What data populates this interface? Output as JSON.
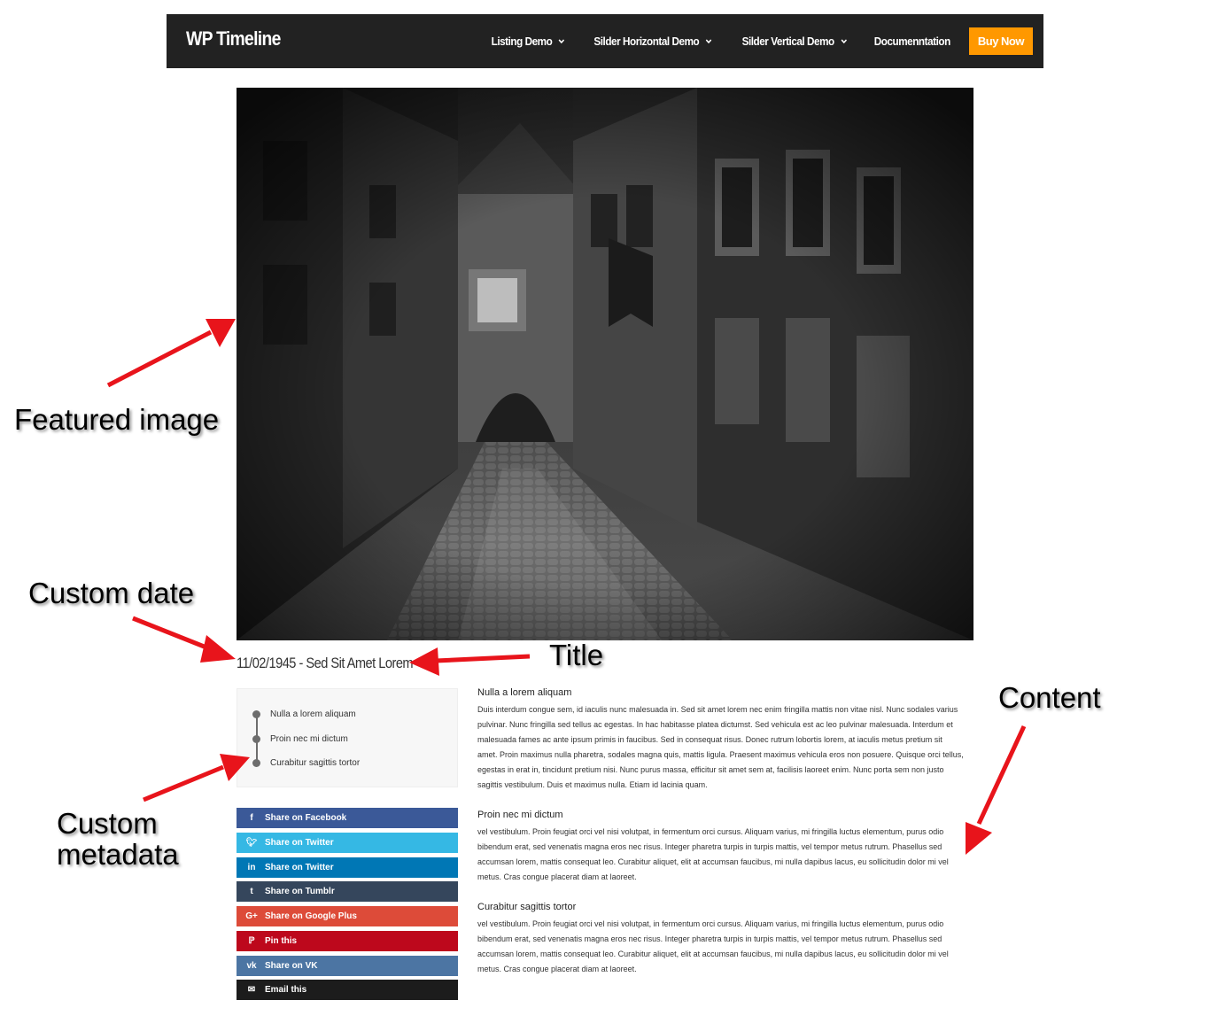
{
  "navbar": {
    "brand": "WP Timeline",
    "menu": [
      {
        "label": "Listing Demo",
        "has_dropdown": true
      },
      {
        "label": "Silder Horizontal Demo",
        "has_dropdown": true
      },
      {
        "label": "Silder Vertical Demo",
        "has_dropdown": true
      },
      {
        "label": "Documenntation",
        "has_dropdown": false
      }
    ],
    "buy_label": "Buy Now",
    "buy_color": "#ff9800"
  },
  "post": {
    "title": "11/02/1945 - Sed Sit Amet Lorem"
  },
  "metadata": [
    "Nulla a lorem aliquam",
    "Proin nec mi dictum",
    "Curabitur sagittis tortor"
  ],
  "share": [
    {
      "label": "Share on Facebook",
      "icon": "facebook-icon",
      "color": "#3b5998"
    },
    {
      "label": "Share on Twitter",
      "icon": "twitter-icon",
      "color": "#35b8e4"
    },
    {
      "label": "Share on Twitter",
      "icon": "linkedin-icon",
      "color": "#0077b5"
    },
    {
      "label": "Share on Tumblr",
      "icon": "tumblr-icon",
      "color": "#35465c"
    },
    {
      "label": "Share on Google Plus",
      "icon": "google-plus-icon",
      "color": "#dd4b39"
    },
    {
      "label": "Pin this",
      "icon": "pinterest-icon",
      "color": "#bd081c"
    },
    {
      "label": "Share on VK",
      "icon": "vk-icon",
      "color": "#4c75a3"
    },
    {
      "label": "Email this",
      "icon": "email-icon",
      "color": "#1c1c1c"
    }
  ],
  "content": [
    {
      "heading": "Nulla a lorem aliquam",
      "lines": [
        "Duis interdum congue sem, id iaculis nunc malesuada in. Sed sit amet lorem nec enim fringilla mattis non vitae nisl. Nunc sodales varius",
        "pulvinar. Nunc fringilla sed tellus ac egestas. In hac habitasse platea dictumst. Sed vehicula est ac leo pulvinar malesuada. Interdum et",
        "malesuada fames ac ante ipsum primis in faucibus. Sed in consequat risus. Donec rutrum lobortis lorem, at iaculis metus pretium sit",
        "amet. Proin maximus nulla pharetra, sodales magna quis, mattis ligula. Praesent maximus vehicula eros non posuere. Quisque orci tellus,",
        "egestas in erat in, tincidunt pretium nisi. Nunc purus massa, efficitur sit amet sem at, facilisis laoreet enim. Nunc porta sem non justo",
        "sagittis vestibulum. Duis et maximus nulla. Etiam id lacinia quam."
      ]
    },
    {
      "heading": "Proin nec mi dictum",
      "lines": [
        "vel vestibulum. Proin feugiat orci vel nisi volutpat, in fermentum orci cursus. Aliquam varius, mi fringilla luctus elementum, purus odio",
        "bibendum erat, sed venenatis magna eros nec risus. Integer pharetra turpis in turpis mattis, vel tempor metus rutrum. Phasellus sed",
        "accumsan lorem, mattis consequat leo. Curabitur aliquet, elit at accumsan faucibus, mi nulla dapibus lacus, eu sollicitudin dolor mi vel",
        "metus. Cras congue placerat diam at laoreet."
      ]
    },
    {
      "heading": "Curabitur sagittis tortor",
      "lines": [
        "vel vestibulum. Proin feugiat orci vel nisi volutpat, in fermentum orci cursus. Aliquam varius, mi fringilla luctus elementum, purus odio",
        "bibendum erat, sed venenatis magna eros nec risus. Integer pharetra turpis in turpis mattis, vel tempor metus rutrum. Phasellus sed",
        "accumsan lorem, mattis consequat leo. Curabitur aliquet, elit at accumsan faucibus, mi nulla dapibus lacus, eu sollicitudin dolor mi vel",
        "metus. Cras congue placerat diam at laoreet."
      ]
    }
  ],
  "annotations": {
    "featured_image": "Featured image",
    "custom_date": "Custom date",
    "title": "Title",
    "content": "Content",
    "custom_metadata_line1": "Custom",
    "custom_metadata_line2": "metadata",
    "arrow_color": "#e8141b"
  }
}
